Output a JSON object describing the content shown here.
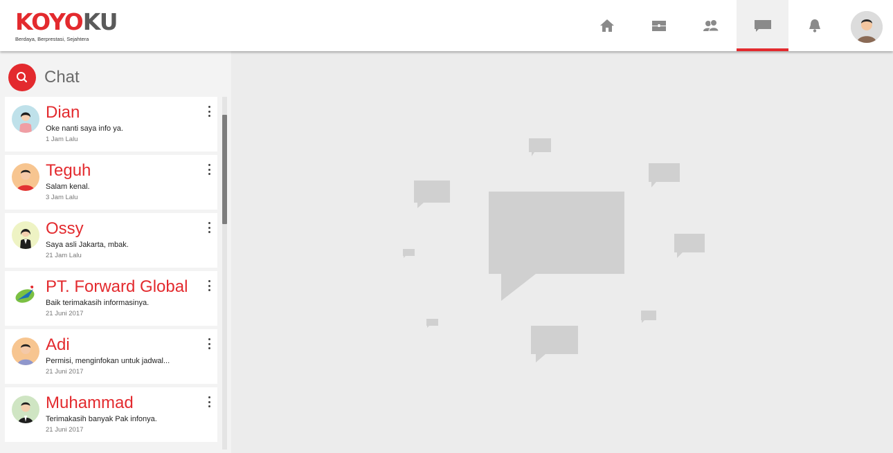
{
  "brand": {
    "logo_part1": "KOYO",
    "logo_part2": "KU",
    "tagline": "Berdaya, Berprestasi, Sejahtera",
    "accent_color": "#e32a2e"
  },
  "nav": [
    {
      "name": "home",
      "icon": "home-icon",
      "active": false
    },
    {
      "name": "jobs",
      "icon": "briefcase-icon",
      "active": false
    },
    {
      "name": "connections",
      "icon": "people-icon",
      "active": false
    },
    {
      "name": "chat",
      "icon": "chat-bubble-icon",
      "active": true
    },
    {
      "name": "notifications",
      "icon": "bell-icon",
      "active": false
    }
  ],
  "sidebar": {
    "title": "Chat",
    "search_icon": "search-icon"
  },
  "chats": [
    {
      "name": "Dian",
      "message": "Oke nanti saya info ya.",
      "time": "1 Jam Lalu",
      "avatar": "woman-avatar"
    },
    {
      "name": "Teguh",
      "message": "Salam kenal.",
      "time": "3 Jam Lalu",
      "avatar": "man-red-shirt-avatar"
    },
    {
      "name": "Ossy",
      "message": "Saya asli Jakarta, mbak.",
      "time": "21 Jam Lalu",
      "avatar": "woman-suit-avatar"
    },
    {
      "name": "PT. Forward Global",
      "message": "Baik terimakasih informasinya.",
      "time": "21 Juni 2017",
      "avatar": "company-logo"
    },
    {
      "name": "Adi",
      "message": "Permisi, menginfokan untuk jadwal...",
      "time": "21 Juni 2017",
      "avatar": "man-purple-shirt-avatar"
    },
    {
      "name": "Muhammad",
      "message": "Terimakasih banyak Pak infonya.",
      "time": "21 Juni 2017",
      "avatar": "man-suit-avatar"
    }
  ]
}
